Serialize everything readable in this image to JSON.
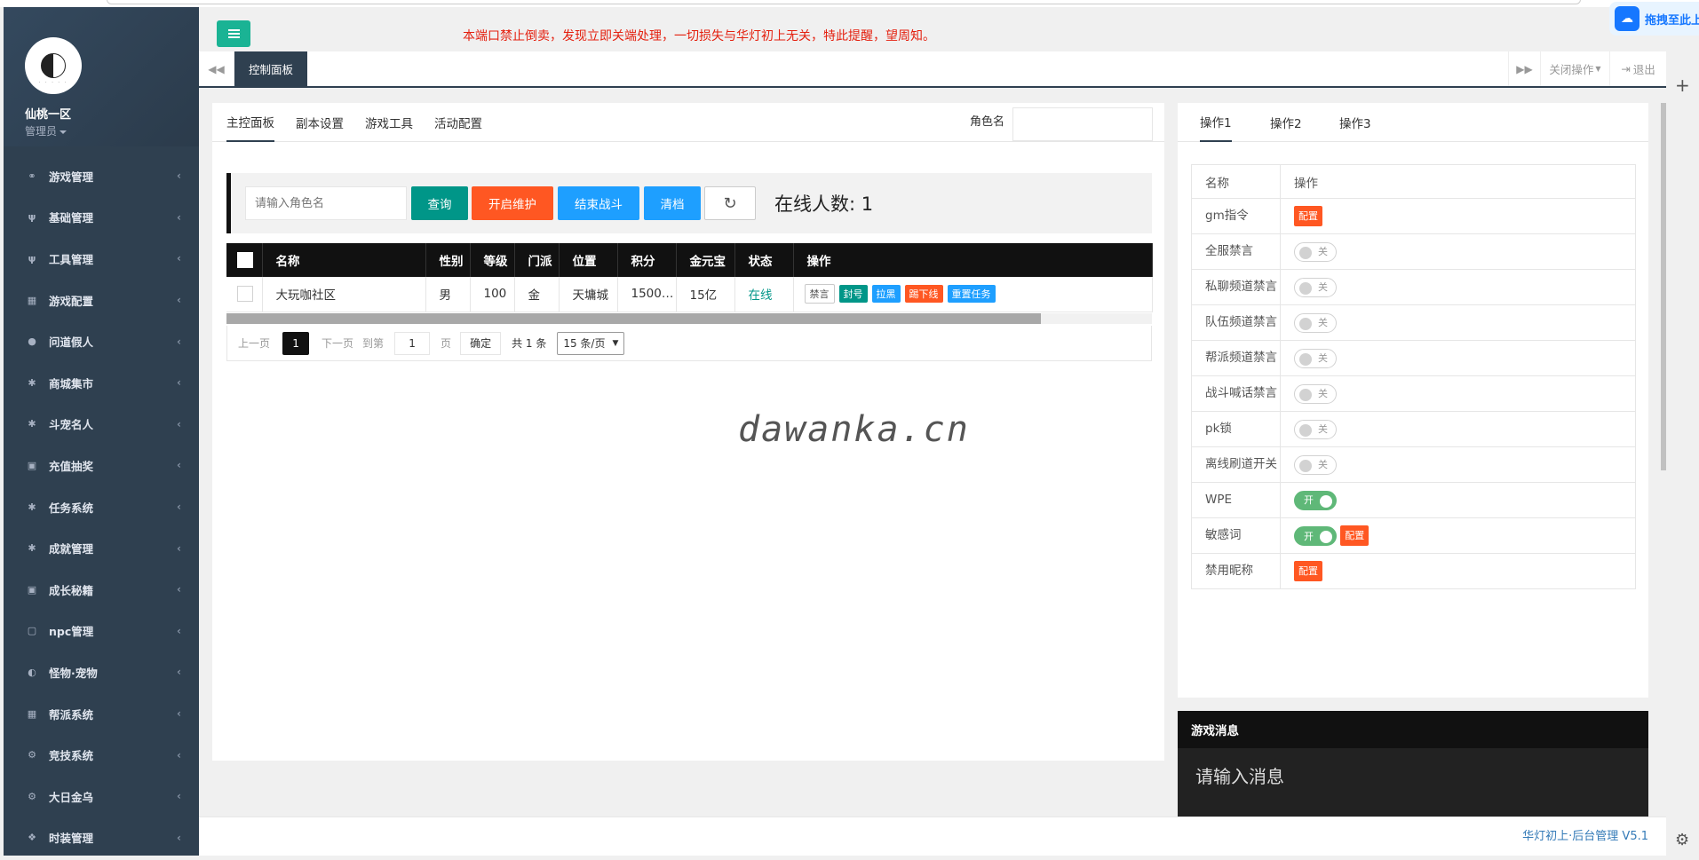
{
  "notice": "本端口禁止倒卖，发现立即关端处理，一切损失与华灯初上无关，特此提醒，望周知。",
  "cloud_badge": "拖拽至此上",
  "sidebar": {
    "server_name": "仙桃一区",
    "role": "管理员",
    "items": [
      {
        "label": "游戏管理",
        "icon": "link-icon"
      },
      {
        "label": "基础管理",
        "icon": "cutlery-icon"
      },
      {
        "label": "工具管理",
        "icon": "cutlery-icon"
      },
      {
        "label": "游戏配置",
        "icon": "table-icon"
      },
      {
        "label": "问道假人",
        "icon": "user-icon"
      },
      {
        "label": "商城集市",
        "icon": "asterisk-icon"
      },
      {
        "label": "斗宠名人",
        "icon": "asterisk-icon"
      },
      {
        "label": "充值抽奖",
        "icon": "money-icon"
      },
      {
        "label": "任务系统",
        "icon": "asterisk-icon"
      },
      {
        "label": "成就管理",
        "icon": "asterisk-icon"
      },
      {
        "label": "成长秘籍",
        "icon": "money-icon"
      },
      {
        "label": "npc管理",
        "icon": "square-icon"
      },
      {
        "label": "怪物·宠物",
        "icon": "adjust-icon"
      },
      {
        "label": "帮派系统",
        "icon": "table-icon"
      },
      {
        "label": "竞技系统",
        "icon": "gears-icon"
      },
      {
        "label": "大日金乌",
        "icon": "gears-icon"
      },
      {
        "label": "时装管理",
        "icon": "cubes-icon"
      }
    ]
  },
  "tabbar": {
    "active_tab": "控制面板",
    "close_ops": "关闭操作",
    "logout": "退出"
  },
  "left_panel": {
    "tabs": [
      "主控面板",
      "副本设置",
      "游戏工具",
      "活动配置"
    ],
    "role_label": "角色名",
    "search_placeholder": "请输入角色名",
    "buttons": {
      "query": "查询",
      "maintenance": "开启维护",
      "end_fight": "结束战斗",
      "clear": "清档",
      "refresh": "↻"
    },
    "online_label": "在线人数:",
    "online_count": "1",
    "table": {
      "headers": [
        "名称",
        "性别",
        "等级",
        "门派",
        "位置",
        "积分",
        "金元宝",
        "状态",
        "操作"
      ],
      "rows": [
        {
          "name": "大玩咖社区",
          "gender": "男",
          "level": "100",
          "faction": "金",
          "location": "天墉城",
          "score": "1500…",
          "gold": "15亿",
          "status": "在线",
          "ops": [
            "禁言",
            "封号",
            "拉黑",
            "踢下线",
            "重置任务"
          ]
        }
      ]
    },
    "pager": {
      "prev": "上一页",
      "current": "1",
      "next": "下一页",
      "goto": "到第",
      "goto_value": "1",
      "page_unit": "页",
      "confirm": "确定",
      "total": "共 1 条",
      "page_size": "15 条/页"
    },
    "watermark": "dawanka.cn"
  },
  "right_panel": {
    "tabs": [
      "操作1",
      "操作2",
      "操作3"
    ],
    "headers": [
      "名称",
      "操作"
    ],
    "config_label": "配置",
    "off_label": "关",
    "on_label": "开",
    "rows": [
      {
        "name": "gm指令",
        "type": "config"
      },
      {
        "name": "全服禁言",
        "type": "switch",
        "on": false
      },
      {
        "name": "私聊频道禁言",
        "type": "switch",
        "on": false
      },
      {
        "name": "队伍频道禁言",
        "type": "switch",
        "on": false
      },
      {
        "name": "帮派频道禁言",
        "type": "switch",
        "on": false
      },
      {
        "name": "战斗喊话禁言",
        "type": "switch",
        "on": false
      },
      {
        "name": "pk锁",
        "type": "switch",
        "on": false
      },
      {
        "name": "离线刷道开关",
        "type": "switch",
        "on": false
      },
      {
        "name": "WPE",
        "type": "switch",
        "on": true,
        "highlight": true
      },
      {
        "name": "敏感词",
        "type": "switch_config",
        "on": true
      },
      {
        "name": "禁用昵称",
        "type": "config"
      }
    ]
  },
  "message_panel": {
    "title": "游戏消息",
    "placeholder": "请输入消息"
  },
  "footer": "华灯初上·后台管理 V5.1",
  "colors": {
    "sidebar_bg": "#2f4050",
    "accent_green": "#1ab394",
    "teal": "#009688",
    "orange": "#ff5722",
    "blue": "#1e9fff",
    "notice_red": "#e4200f"
  }
}
